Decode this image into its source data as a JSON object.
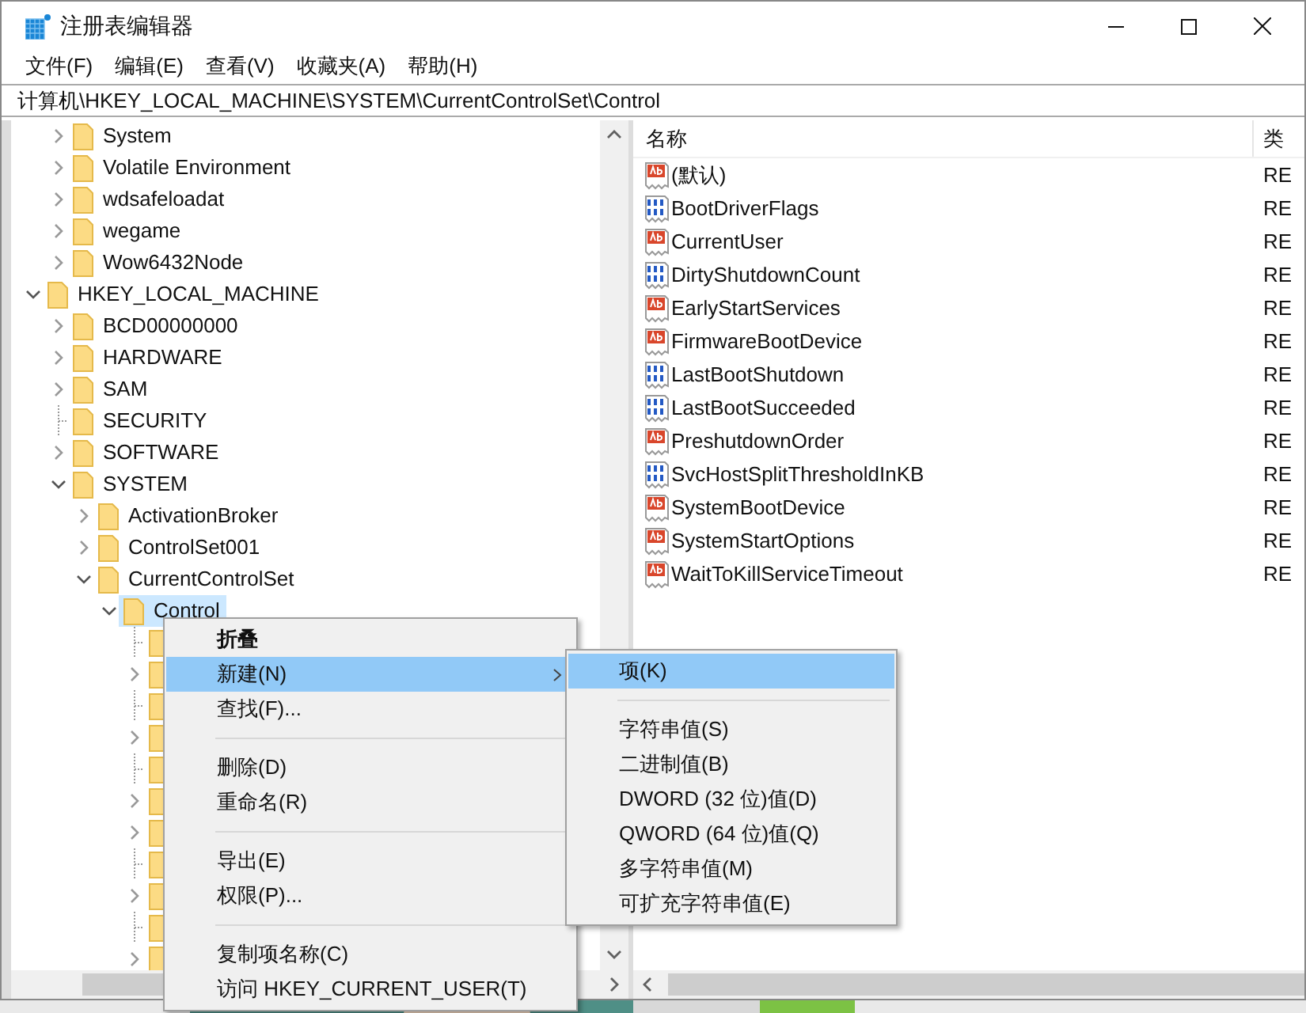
{
  "window": {
    "title": "注册表编辑器"
  },
  "menu_bar": [
    "文件(F)",
    "编辑(E)",
    "查看(V)",
    "收藏夹(A)",
    "帮助(H)"
  ],
  "address": "计算机\\HKEY_LOCAL_MACHINE\\SYSTEM\\CurrentControlSet\\Control",
  "tree": {
    "scrolled_parent_children": [
      {
        "label": "System",
        "has_children": true,
        "expanded": false,
        "selected": false
      },
      {
        "label": "Volatile Environment",
        "has_children": true,
        "expanded": false,
        "selected": false
      },
      {
        "label": "wdsafeloadat",
        "has_children": true,
        "expanded": false,
        "selected": false
      },
      {
        "label": "wegame",
        "has_children": true,
        "expanded": false,
        "selected": false
      },
      {
        "label": "Wow6432Node",
        "has_children": true,
        "expanded": false,
        "selected": false
      }
    ],
    "roots": [
      {
        "label": "HKEY_LOCAL_MACHINE",
        "has_children": true,
        "expanded": true,
        "selected": false,
        "children": [
          {
            "label": "BCD00000000",
            "has_children": true,
            "expanded": false,
            "selected": false
          },
          {
            "label": "HARDWARE",
            "has_children": true,
            "expanded": false,
            "selected": false
          },
          {
            "label": "SAM",
            "has_children": true,
            "expanded": false,
            "selected": false
          },
          {
            "label": "SECURITY",
            "has_children": false,
            "expanded": false,
            "selected": false
          },
          {
            "label": "SOFTWARE",
            "has_children": true,
            "expanded": false,
            "selected": false
          },
          {
            "label": "SYSTEM",
            "has_children": true,
            "expanded": true,
            "selected": false,
            "children": [
              {
                "label": "ActivationBroker",
                "has_children": true,
                "expanded": false,
                "selected": false
              },
              {
                "label": "ControlSet001",
                "has_children": true,
                "expanded": false,
                "selected": false
              },
              {
                "label": "CurrentControlSet",
                "has_children": true,
                "expanded": true,
                "selected": false,
                "children": [
                  {
                    "label": "Control",
                    "has_children": true,
                    "expanded": true,
                    "selected": true,
                    "children": [
                      {
                        "has_children": false,
                        "expanded": false,
                        "selected": false
                      },
                      {
                        "has_children": true,
                        "expanded": false,
                        "selected": false
                      },
                      {
                        "has_children": false,
                        "expanded": false,
                        "selected": false
                      },
                      {
                        "has_children": true,
                        "expanded": false,
                        "selected": false
                      },
                      {
                        "has_children": false,
                        "expanded": false,
                        "selected": false
                      },
                      {
                        "has_children": true,
                        "expanded": false,
                        "selected": false
                      },
                      {
                        "has_children": true,
                        "expanded": false,
                        "selected": false
                      },
                      {
                        "has_children": false,
                        "expanded": false,
                        "selected": false
                      },
                      {
                        "has_children": true,
                        "expanded": false,
                        "selected": false
                      },
                      {
                        "has_children": false,
                        "expanded": false,
                        "selected": false
                      },
                      {
                        "has_children": true,
                        "expanded": false,
                        "selected": false
                      }
                    ]
                  }
                ]
              }
            ]
          }
        ]
      }
    ]
  },
  "values": {
    "columns": [
      "名称",
      "类"
    ],
    "rows": [
      {
        "name": "(默认)",
        "kind": "string",
        "type": "RE"
      },
      {
        "name": "BootDriverFlags",
        "kind": "binary",
        "type": "RE"
      },
      {
        "name": "CurrentUser",
        "kind": "string",
        "type": "RE"
      },
      {
        "name": "DirtyShutdownCount",
        "kind": "binary",
        "type": "RE"
      },
      {
        "name": "EarlyStartServices",
        "kind": "string",
        "type": "RE"
      },
      {
        "name": "FirmwareBootDevice",
        "kind": "string",
        "type": "RE"
      },
      {
        "name": "LastBootShutdown",
        "kind": "binary",
        "type": "RE"
      },
      {
        "name": "LastBootSucceeded",
        "kind": "binary",
        "type": "RE"
      },
      {
        "name": "PreshutdownOrder",
        "kind": "string",
        "type": "RE"
      },
      {
        "name": "SvcHostSplitThresholdInKB",
        "kind": "binary",
        "type": "RE"
      },
      {
        "name": "SystemBootDevice",
        "kind": "string",
        "type": "RE"
      },
      {
        "name": "SystemStartOptions",
        "kind": "string",
        "type": "RE"
      },
      {
        "name": "WaitToKillServiceTimeout",
        "kind": "string",
        "type": "RE"
      }
    ]
  },
  "context_menu": [
    {
      "kind": "item",
      "label": "折叠",
      "bold": true,
      "selected": false,
      "submenu": false
    },
    {
      "kind": "item",
      "label": "新建(N)",
      "bold": false,
      "selected": true,
      "submenu": true
    },
    {
      "kind": "item",
      "label": "查找(F)...",
      "bold": false,
      "selected": false,
      "submenu": false
    },
    {
      "kind": "separator"
    },
    {
      "kind": "item",
      "label": "删除(D)",
      "bold": false,
      "selected": false,
      "submenu": false
    },
    {
      "kind": "item",
      "label": "重命名(R)",
      "bold": false,
      "selected": false,
      "submenu": false
    },
    {
      "kind": "separator"
    },
    {
      "kind": "item",
      "label": "导出(E)",
      "bold": false,
      "selected": false,
      "submenu": false
    },
    {
      "kind": "item",
      "label": "权限(P)...",
      "bold": false,
      "selected": false,
      "submenu": false
    },
    {
      "kind": "separator"
    },
    {
      "kind": "item",
      "label": "复制项名称(C)",
      "bold": false,
      "selected": false,
      "submenu": false
    },
    {
      "kind": "item",
      "label": "访问 HKEY_CURRENT_USER(T)",
      "bold": false,
      "selected": false,
      "submenu": false
    }
  ],
  "submenu": [
    {
      "kind": "item",
      "label": "项(K)",
      "selected": true
    },
    {
      "kind": "separator"
    },
    {
      "kind": "item",
      "label": "字符串值(S)",
      "selected": false
    },
    {
      "kind": "item",
      "label": "二进制值(B)",
      "selected": false
    },
    {
      "kind": "item",
      "label": "DWORD (32 位)值(D)",
      "selected": false
    },
    {
      "kind": "item",
      "label": "QWORD (64 位)值(Q)",
      "selected": false
    },
    {
      "kind": "item",
      "label": "多字符串值(M)",
      "selected": false
    },
    {
      "kind": "item",
      "label": "可扩充字符串值(E)",
      "selected": false
    }
  ]
}
